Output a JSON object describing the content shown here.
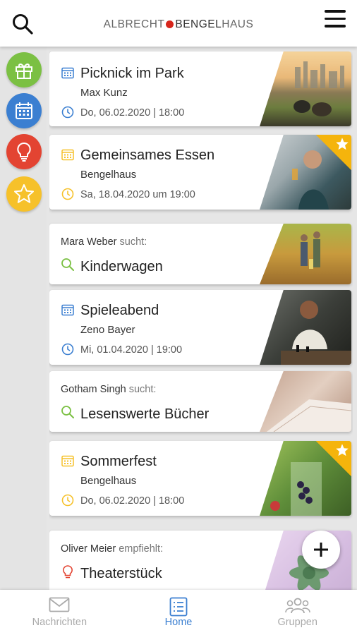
{
  "header": {
    "logo_part1": "ALBRECHT",
    "logo_part2": "BENGEL",
    "logo_part3": "HAUS"
  },
  "sidebar": {
    "items": [
      {
        "icon": "gift-icon",
        "color": "#7bc043"
      },
      {
        "icon": "calendar-icon",
        "color": "#3b7fd1"
      },
      {
        "icon": "lightbulb-icon",
        "color": "#e34432"
      },
      {
        "icon": "star-icon",
        "color": "#f6c12a"
      }
    ]
  },
  "cards": [
    {
      "type": "event",
      "title": "Picknick im Park",
      "host": "Max Kunz",
      "date": "Do, 06.02.2020 | 18:00",
      "accent": "#3b7fd1",
      "featured": false,
      "image": "city-picnic-photo"
    },
    {
      "type": "event",
      "title": "Gemeinsames Essen",
      "host": "Bengelhaus",
      "date": "Sa, 18.04.2020 um 19:00",
      "accent": "#f6c12a",
      "featured": true,
      "image": "dinner-photo"
    },
    {
      "type": "search",
      "person": "Mara Weber",
      "verb": "sucht:",
      "title": "Kinderwagen",
      "accent": "#7bc043",
      "image": "family-park-photo"
    },
    {
      "type": "event",
      "title": "Spieleabend",
      "host": "Zeno Bayer",
      "date": "Mi, 01.04.2020 | 19:00",
      "accent": "#3b7fd1",
      "featured": false,
      "image": "chess-photo"
    },
    {
      "type": "search",
      "person": "Gotham Singh",
      "verb": "sucht:",
      "title": "Lesenswerte Bücher",
      "accent": "#7bc043",
      "image": "book-photo"
    },
    {
      "type": "event",
      "title": "Sommerfest",
      "host": "Bengelhaus",
      "date": "Do, 06.02.2020 | 18:00",
      "accent": "#f6c12a",
      "featured": true,
      "image": "berries-drink-photo"
    },
    {
      "type": "recommend",
      "person": "Oliver Meier",
      "verb": "empfiehlt:",
      "title": "Theaterstück",
      "accent": "#e34432",
      "image": "succulent-photo"
    }
  ],
  "fab": {
    "icon": "plus-icon"
  },
  "bottom_nav": [
    {
      "label": "Nachrichten",
      "icon": "envelope-icon",
      "active": false
    },
    {
      "label": "Home",
      "icon": "home-list-icon",
      "active": true
    },
    {
      "label": "Gruppen",
      "icon": "group-icon",
      "active": false
    }
  ]
}
